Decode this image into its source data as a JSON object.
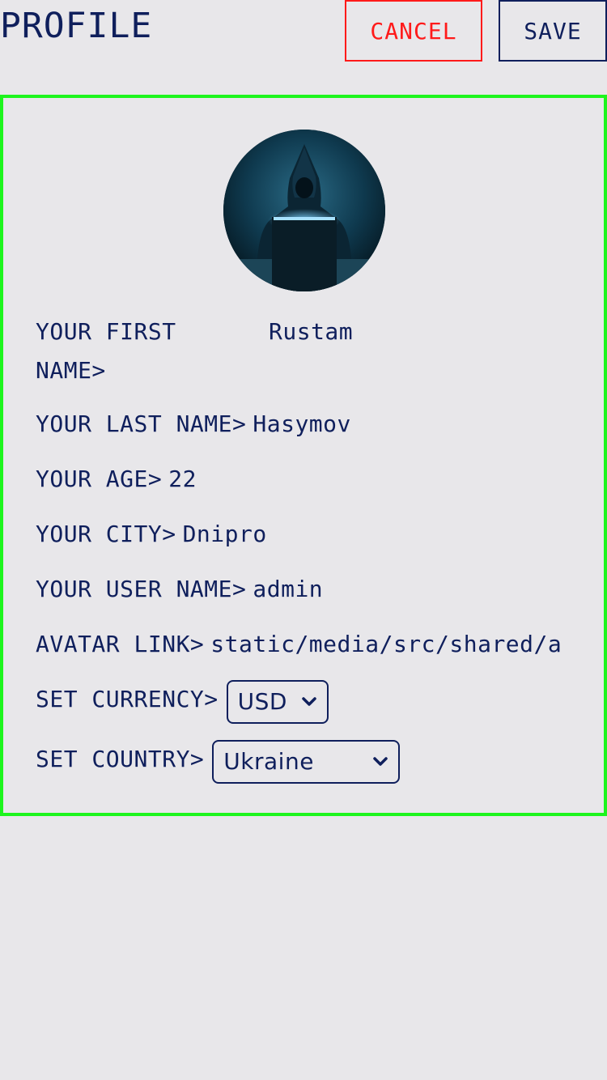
{
  "header": {
    "title": "PROFILE",
    "cancel_label": "CANCEL",
    "save_label": "SAVE"
  },
  "profile": {
    "avatar_icon": "hacker-avatar",
    "fields": {
      "first_name": {
        "label": "YOUR FIRST\nNAME>",
        "value": "Rustam"
      },
      "last_name": {
        "label": "YOUR LAST NAME>",
        "value": "Hasymov"
      },
      "age": {
        "label": "YOUR AGE>",
        "value": "22"
      },
      "city": {
        "label": "YOUR CITY>",
        "value": "Dnipro"
      },
      "user_name": {
        "label": "YOUR USER NAME>",
        "value": "admin"
      },
      "avatar_link": {
        "label": "AVATAR LINK>",
        "value": "static/media/src/shared/a"
      }
    },
    "currency": {
      "label": "SET CURRENCY>",
      "selected": "USD"
    },
    "country": {
      "label": "SET COUNTRY>",
      "selected": "Ukraine"
    }
  },
  "colors": {
    "text": "#0f1f5c",
    "cancel": "#ff1a1a",
    "card_border": "#1df51d",
    "background": "#e8e7ea"
  }
}
